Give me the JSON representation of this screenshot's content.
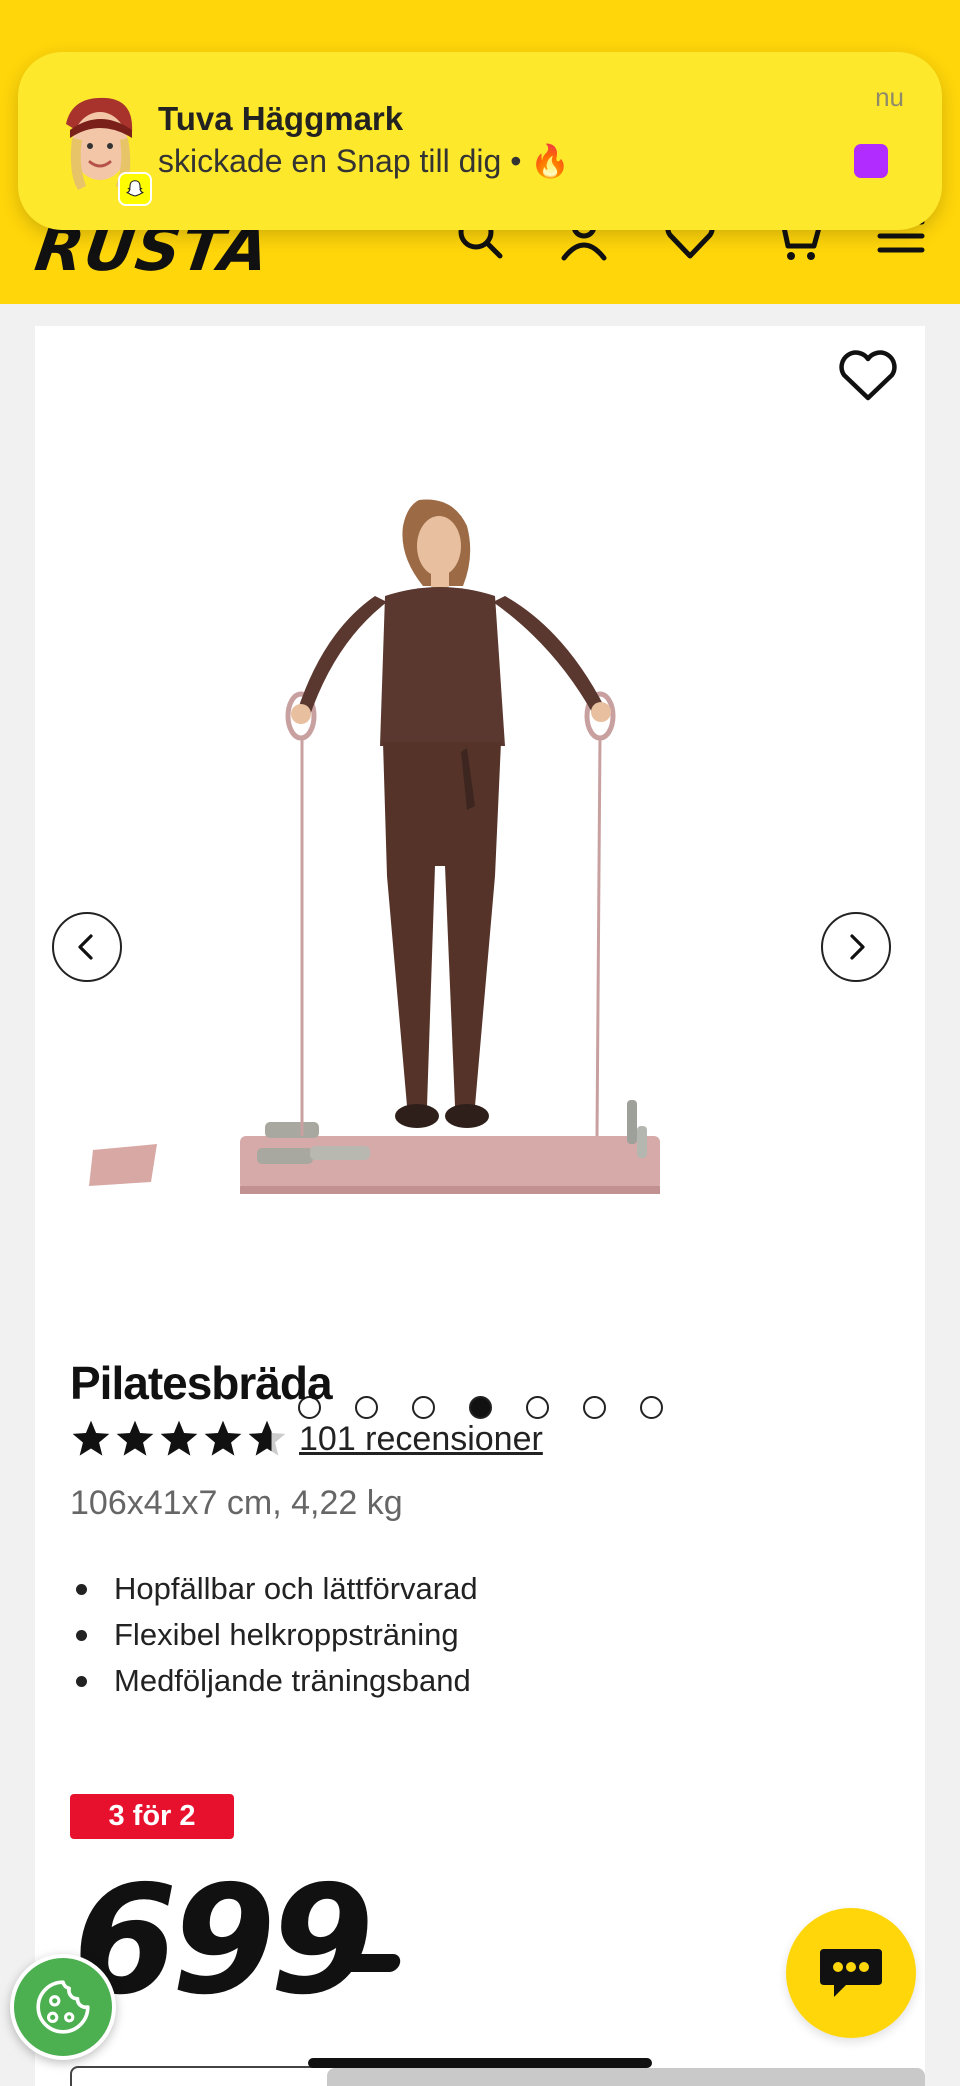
{
  "notification": {
    "sender": "Tuva Häggmark",
    "message": "skickade en Snap till dig • 🔥",
    "time": "nu",
    "app_icon": "snapchat-ghost-icon"
  },
  "header": {
    "logo": "RUSTA",
    "icons": [
      "search-icon",
      "user-icon",
      "heart-icon",
      "cart-icon",
      "menu-icon"
    ]
  },
  "product": {
    "title": "Pilatesbräda",
    "rating": 4.5,
    "rating_max": 5,
    "reviews_label": "101 recensioner",
    "dimensions": "106x41x7 cm, 4,22 kg",
    "features": [
      "Hopfällbar och lättförvarad",
      "Flexibel helkroppsträning",
      "Medföljande träningsband"
    ],
    "badge": "3 för 2",
    "price": "699"
  },
  "gallery": {
    "total_images": 7,
    "active_index": 4
  },
  "colors": {
    "brand_yellow": "#ffd60a",
    "badge_red": "#e8112d",
    "notification_yellow": "#fde82c",
    "snap_purple": "#b12cff",
    "cookie_green": "#4caf50"
  }
}
